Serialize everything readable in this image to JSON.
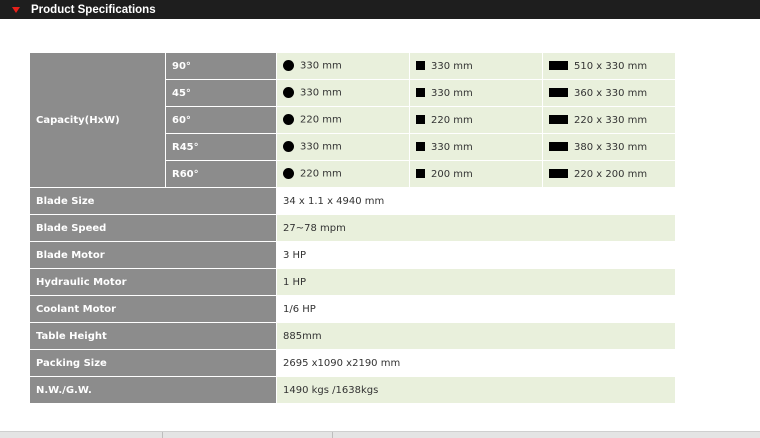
{
  "header": {
    "title": "Product Specifications"
  },
  "capacity": {
    "label": "Capacity(HxW)",
    "rows": [
      {
        "angle": "90°",
        "round": "330 mm",
        "square": "330 mm",
        "rect": "510 x 330 mm"
      },
      {
        "angle": "45°",
        "round": "330 mm",
        "square": "330 mm",
        "rect": "360 x 330 mm"
      },
      {
        "angle": "60°",
        "round": "220 mm",
        "square": "220 mm",
        "rect": "220 x 330 mm"
      },
      {
        "angle": "R45°",
        "round": "330 mm",
        "square": "330 mm",
        "rect": "380 x 330 mm"
      },
      {
        "angle": "R60°",
        "round": "220 mm",
        "square": "200 mm",
        "rect": "220 x 200 mm"
      }
    ]
  },
  "specs": [
    {
      "label": "Blade Size",
      "value": "34 x 1.1 x 4940 mm"
    },
    {
      "label": "Blade Speed",
      "value": "27~78 mpm"
    },
    {
      "label": "Blade Motor",
      "value": "3 HP"
    },
    {
      "label": "Hydraulic Motor",
      "value": "1 HP"
    },
    {
      "label": "Coolant Motor",
      "value": "1/6 HP"
    },
    {
      "label": "Table Height",
      "value": "885mm"
    },
    {
      "label": "Packing Size",
      "value": "2695 x1090 x2190 mm"
    },
    {
      "label": "N.W./G.W.",
      "value": "1490 kgs /1638kgs"
    }
  ],
  "icons": {
    "round": "filled-circle-icon",
    "square": "filled-square-icon",
    "rect": "filled-rectangle-icon"
  },
  "colors": {
    "header_bg": "#1e1e1e",
    "label_bg": "#8c8c8c",
    "alt_row_bg": "#e9f0dc",
    "arrow": "#e8201a"
  }
}
